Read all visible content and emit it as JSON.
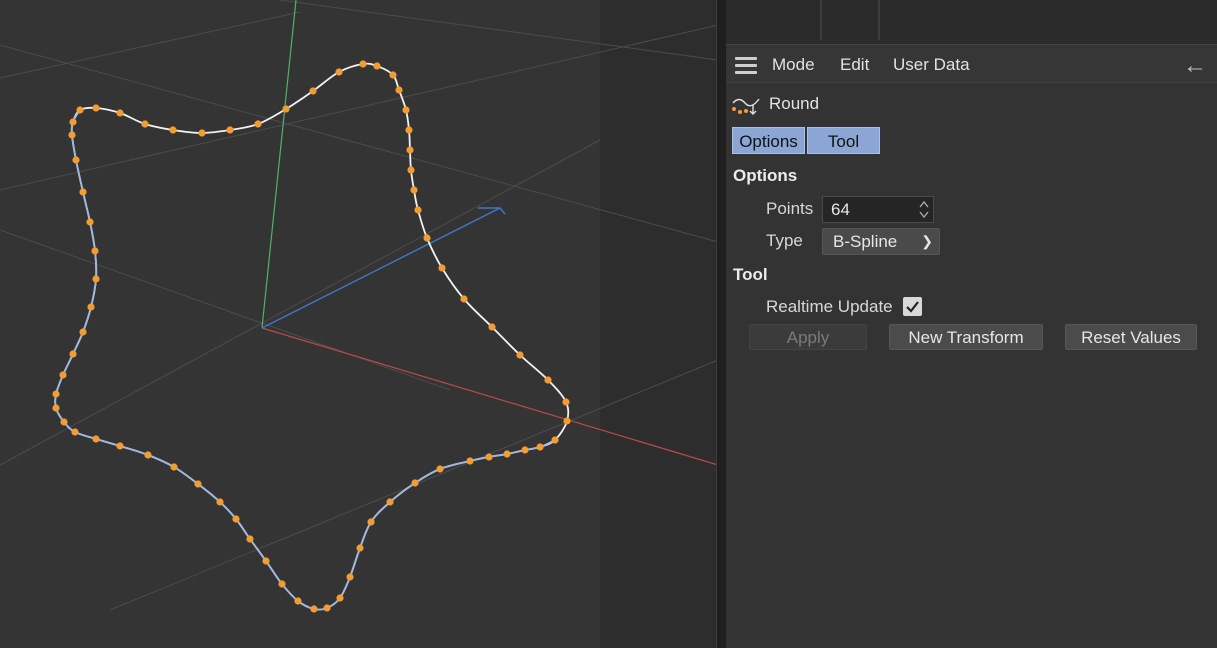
{
  "menubar": {
    "items": [
      "Mode",
      "Edit",
      "User Data"
    ]
  },
  "object": {
    "name": "Round",
    "icon": "spline-round-icon"
  },
  "tabs": [
    "Options",
    "Tool"
  ],
  "options": {
    "heading": "Options",
    "points_label": "Points",
    "points_value": "64",
    "type_label": "Type",
    "type_value": "B-Spline"
  },
  "tool": {
    "heading": "Tool",
    "realtime_label": "Realtime Update",
    "realtime_checked": true,
    "apply_label": "Apply",
    "new_transform_label": "New Transform",
    "reset_values_label": "Reset Values"
  },
  "colors": {
    "tab_active": "#8ba6d5",
    "point": "#f39c32",
    "spline": "#ffffff",
    "axis_x": "#c0392b",
    "axis_y": "#2ecc71",
    "axis_z": "#3f7fd6"
  }
}
